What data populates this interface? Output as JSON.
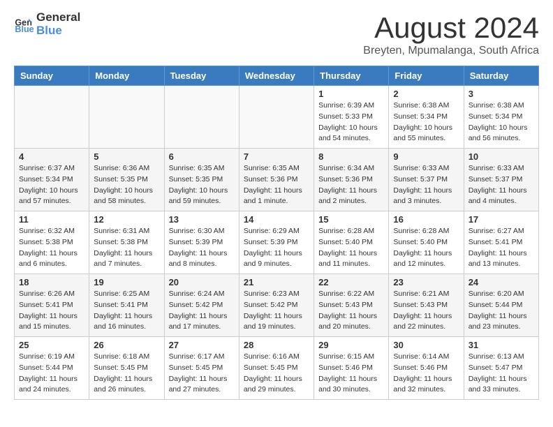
{
  "logo": {
    "line1": "General",
    "line2": "Blue"
  },
  "title": "August 2024",
  "location": "Breyten, Mpumalanga, South Africa",
  "days_of_week": [
    "Sunday",
    "Monday",
    "Tuesday",
    "Wednesday",
    "Thursday",
    "Friday",
    "Saturday"
  ],
  "weeks": [
    [
      {
        "day": "",
        "info": ""
      },
      {
        "day": "",
        "info": ""
      },
      {
        "day": "",
        "info": ""
      },
      {
        "day": "",
        "info": ""
      },
      {
        "day": "1",
        "info": "Sunrise: 6:39 AM\nSunset: 5:33 PM\nDaylight: 10 hours and 54 minutes."
      },
      {
        "day": "2",
        "info": "Sunrise: 6:38 AM\nSunset: 5:34 PM\nDaylight: 10 hours and 55 minutes."
      },
      {
        "day": "3",
        "info": "Sunrise: 6:38 AM\nSunset: 5:34 PM\nDaylight: 10 hours and 56 minutes."
      }
    ],
    [
      {
        "day": "4",
        "info": "Sunrise: 6:37 AM\nSunset: 5:34 PM\nDaylight: 10 hours and 57 minutes."
      },
      {
        "day": "5",
        "info": "Sunrise: 6:36 AM\nSunset: 5:35 PM\nDaylight: 10 hours and 58 minutes."
      },
      {
        "day": "6",
        "info": "Sunrise: 6:35 AM\nSunset: 5:35 PM\nDaylight: 10 hours and 59 minutes."
      },
      {
        "day": "7",
        "info": "Sunrise: 6:35 AM\nSunset: 5:36 PM\nDaylight: 11 hours and 1 minute."
      },
      {
        "day": "8",
        "info": "Sunrise: 6:34 AM\nSunset: 5:36 PM\nDaylight: 11 hours and 2 minutes."
      },
      {
        "day": "9",
        "info": "Sunrise: 6:33 AM\nSunset: 5:37 PM\nDaylight: 11 hours and 3 minutes."
      },
      {
        "day": "10",
        "info": "Sunrise: 6:33 AM\nSunset: 5:37 PM\nDaylight: 11 hours and 4 minutes."
      }
    ],
    [
      {
        "day": "11",
        "info": "Sunrise: 6:32 AM\nSunset: 5:38 PM\nDaylight: 11 hours and 6 minutes."
      },
      {
        "day": "12",
        "info": "Sunrise: 6:31 AM\nSunset: 5:38 PM\nDaylight: 11 hours and 7 minutes."
      },
      {
        "day": "13",
        "info": "Sunrise: 6:30 AM\nSunset: 5:39 PM\nDaylight: 11 hours and 8 minutes."
      },
      {
        "day": "14",
        "info": "Sunrise: 6:29 AM\nSunset: 5:39 PM\nDaylight: 11 hours and 9 minutes."
      },
      {
        "day": "15",
        "info": "Sunrise: 6:28 AM\nSunset: 5:40 PM\nDaylight: 11 hours and 11 minutes."
      },
      {
        "day": "16",
        "info": "Sunrise: 6:28 AM\nSunset: 5:40 PM\nDaylight: 11 hours and 12 minutes."
      },
      {
        "day": "17",
        "info": "Sunrise: 6:27 AM\nSunset: 5:41 PM\nDaylight: 11 hours and 13 minutes."
      }
    ],
    [
      {
        "day": "18",
        "info": "Sunrise: 6:26 AM\nSunset: 5:41 PM\nDaylight: 11 hours and 15 minutes."
      },
      {
        "day": "19",
        "info": "Sunrise: 6:25 AM\nSunset: 5:41 PM\nDaylight: 11 hours and 16 minutes."
      },
      {
        "day": "20",
        "info": "Sunrise: 6:24 AM\nSunset: 5:42 PM\nDaylight: 11 hours and 17 minutes."
      },
      {
        "day": "21",
        "info": "Sunrise: 6:23 AM\nSunset: 5:42 PM\nDaylight: 11 hours and 19 minutes."
      },
      {
        "day": "22",
        "info": "Sunrise: 6:22 AM\nSunset: 5:43 PM\nDaylight: 11 hours and 20 minutes."
      },
      {
        "day": "23",
        "info": "Sunrise: 6:21 AM\nSunset: 5:43 PM\nDaylight: 11 hours and 22 minutes."
      },
      {
        "day": "24",
        "info": "Sunrise: 6:20 AM\nSunset: 5:44 PM\nDaylight: 11 hours and 23 minutes."
      }
    ],
    [
      {
        "day": "25",
        "info": "Sunrise: 6:19 AM\nSunset: 5:44 PM\nDaylight: 11 hours and 24 minutes."
      },
      {
        "day": "26",
        "info": "Sunrise: 6:18 AM\nSunset: 5:45 PM\nDaylight: 11 hours and 26 minutes."
      },
      {
        "day": "27",
        "info": "Sunrise: 6:17 AM\nSunset: 5:45 PM\nDaylight: 11 hours and 27 minutes."
      },
      {
        "day": "28",
        "info": "Sunrise: 6:16 AM\nSunset: 5:45 PM\nDaylight: 11 hours and 29 minutes."
      },
      {
        "day": "29",
        "info": "Sunrise: 6:15 AM\nSunset: 5:46 PM\nDaylight: 11 hours and 30 minutes."
      },
      {
        "day": "30",
        "info": "Sunrise: 6:14 AM\nSunset: 5:46 PM\nDaylight: 11 hours and 32 minutes."
      },
      {
        "day": "31",
        "info": "Sunrise: 6:13 AM\nSunset: 5:47 PM\nDaylight: 11 hours and 33 minutes."
      }
    ]
  ]
}
